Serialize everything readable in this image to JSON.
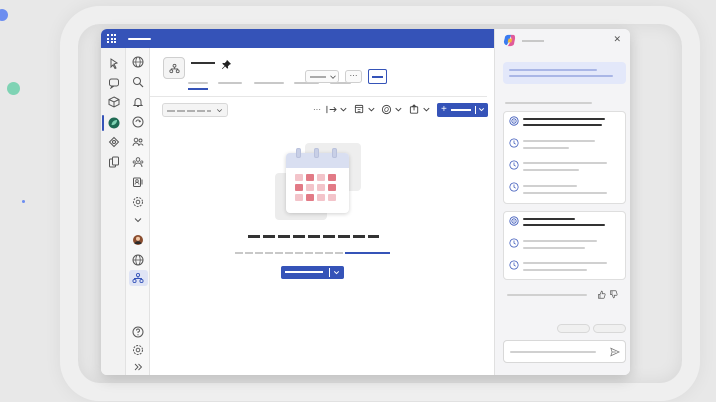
{
  "window": {
    "app_launcher_icon": "grid-icon"
  },
  "rail": {
    "items": [
      {
        "icon": "activity-icon"
      },
      {
        "icon": "chat-icon"
      },
      {
        "icon": "teams-icon"
      },
      {
        "icon": "app-leaf-icon",
        "active": true
      },
      {
        "icon": "apps-icon"
      },
      {
        "icon": "files-icon"
      }
    ]
  },
  "rail2": {
    "items": [
      {
        "icon": "globe-icon"
      },
      {
        "icon": "search-icon"
      },
      {
        "icon": "bell-icon"
      },
      {
        "icon": "sync-icon"
      },
      {
        "icon": "people-icon"
      },
      {
        "icon": "people-group-icon"
      },
      {
        "icon": "contacts-icon"
      },
      {
        "icon": "settings-icon"
      },
      {
        "icon": "chevron-down-icon"
      },
      {
        "icon": "avatar-icon"
      },
      {
        "icon": "globe-icon"
      },
      {
        "icon": "hierarchy-icon",
        "active": true
      },
      {
        "icon": "help-icon"
      },
      {
        "icon": "settings-icon"
      },
      {
        "icon": "expand-icon"
      }
    ]
  },
  "main": {
    "more_glyph": "···",
    "toolbar": {
      "more_glyph": "···",
      "new_glyph": "+"
    }
  },
  "copilot": {
    "close_glyph": "✕",
    "send_icon": "send-icon"
  },
  "colors": {
    "brand": "#3553b8",
    "copilot_banner": "#e3e8fa",
    "calendar_red": "#e27a86",
    "calendar_pink": "#f3c4ca"
  }
}
